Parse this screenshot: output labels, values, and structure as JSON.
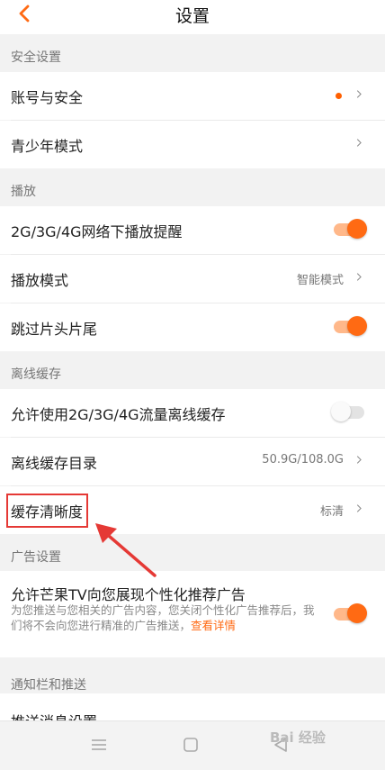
{
  "header": {
    "title": "设置"
  },
  "sections": {
    "security": "安全设置",
    "playback": "播放",
    "offline": "离线缓存",
    "ads": "广告设置",
    "notify": "通知栏和推送"
  },
  "rows": {
    "account": {
      "label": "账号与安全"
    },
    "teen": {
      "label": "青少年模式"
    },
    "network_remind": {
      "label": "2G/3G/4G网络下播放提醒",
      "toggle": true
    },
    "play_mode": {
      "label": "播放模式",
      "value": "智能模式"
    },
    "skip": {
      "label": "跳过片头片尾",
      "toggle": true
    },
    "allow_cache": {
      "label": "允许使用2G/3G/4G流量离线缓存",
      "toggle": false
    },
    "cache_dir": {
      "label": "离线缓存目录",
      "value": "50.9G/108.0G"
    },
    "cache_quality": {
      "label": "缓存清晰度",
      "value": "标清"
    },
    "personal_ads": {
      "label": "允许芒果TV向您展现个性化推荐广告",
      "desc": "为您推送与您相关的广告内容，您关闭个性化广告推荐后，我们将不会向您进行精准的广告推送，",
      "link": "查看详情",
      "toggle": true
    },
    "push_settings": {
      "label": "推送消息设置"
    }
  },
  "watermark": "Bai 经验",
  "colors": {
    "accent": "#ff6a13",
    "annotation": "#e53935"
  },
  "icons": [
    "back-arrow-icon",
    "chevron-right-icon",
    "menu-icon",
    "home-square-icon",
    "back-triangle-icon"
  ]
}
